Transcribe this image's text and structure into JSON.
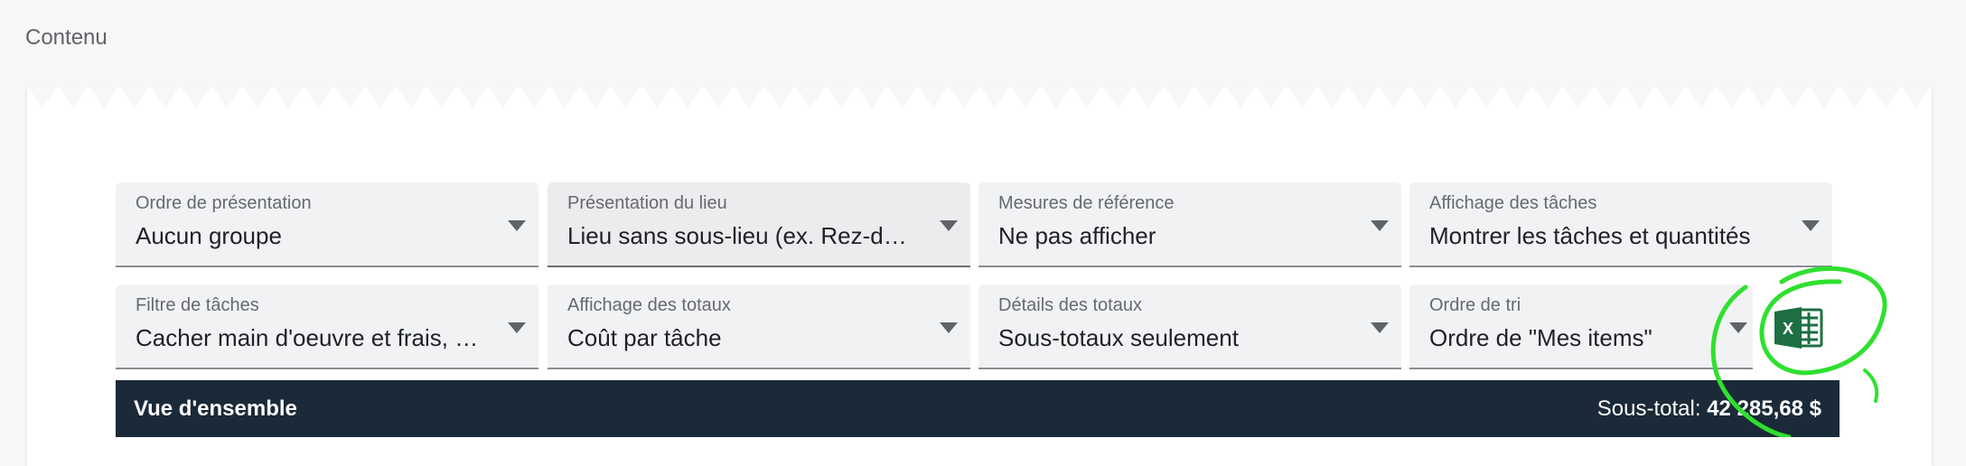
{
  "page": {
    "section_label": "Contenu"
  },
  "filters": [
    {
      "label": "Ordre de présentation",
      "value": "Aucun groupe"
    },
    {
      "label": "Présentation du lieu",
      "value": "Lieu sans sous-lieu (ex. Rez-de-chaussée)"
    },
    {
      "label": "Mesures de référence",
      "value": "Ne pas afficher"
    },
    {
      "label": "Affichage des tâches",
      "value": "Montrer les tâches et quantités"
    },
    {
      "label": "Filtre de tâches",
      "value": "Cacher main d'oeuvre et frais, …"
    },
    {
      "label": "Affichage des totaux",
      "value": "Coût par tâche"
    },
    {
      "label": "Détails des totaux",
      "value": "Sous-totaux seulement"
    },
    {
      "label": "Ordre de tri",
      "value": "Ordre de \"Mes items\""
    }
  ],
  "export": {
    "icon": "excel-icon",
    "glyph": "X",
    "color": "#1d6f42"
  },
  "overview": {
    "title": "Vue d'ensemble",
    "subtotal_label": "Sous-total:",
    "subtotal_value": "42 285,68 $"
  },
  "colors": {
    "overview_bg": "#1b2a38",
    "annotation": "#2fe02f"
  }
}
